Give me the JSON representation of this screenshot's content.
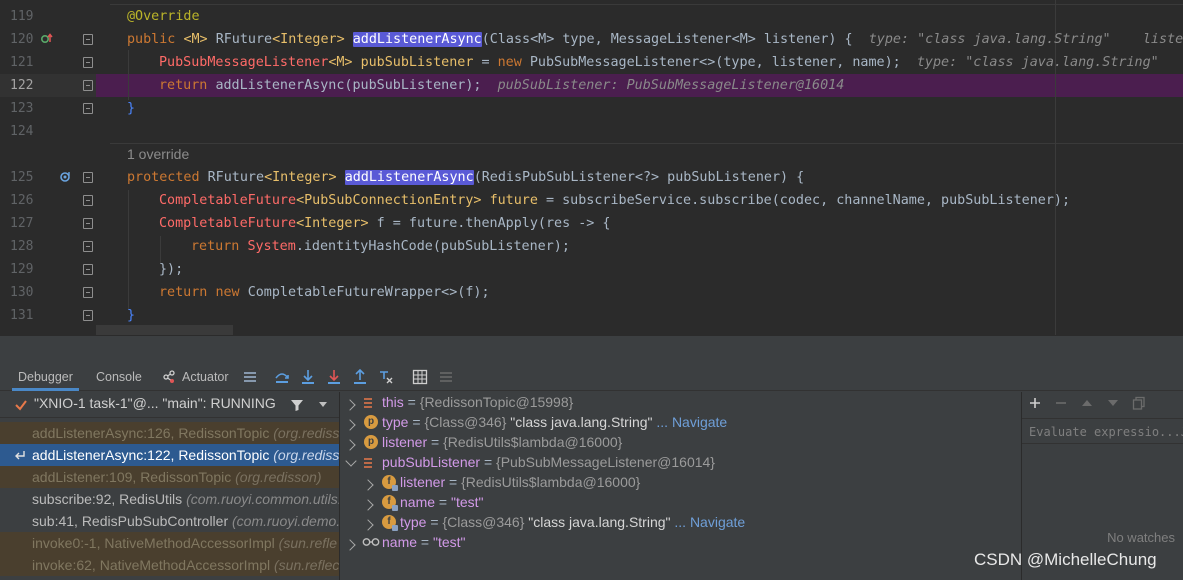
{
  "editor": {
    "lines": [
      {
        "num": "119"
      },
      {
        "num": "120"
      },
      {
        "num": "121"
      },
      {
        "num": "122"
      },
      {
        "num": "123"
      },
      {
        "num": "124"
      },
      {
        "num": "125"
      },
      {
        "num": "126"
      },
      {
        "num": "127"
      },
      {
        "num": "128"
      },
      {
        "num": "129"
      },
      {
        "num": "130"
      },
      {
        "num": "131"
      }
    ],
    "usage_hint": "1 override",
    "code": {
      "l119_ann": "@Override",
      "l120_kw": "public",
      "l120_gen": "<M>",
      "l120_type": "RFuture",
      "l120_tparam": "<Integer>",
      "l120_method": "addListenerAsync",
      "l120_params": "(Class<M> type, MessageListener<M> listener) {",
      "l120_hint": "type: \"class java.lang.String\"",
      "l120_hint2": "lister",
      "l121_type": "PubSubMessageListener",
      "l121_gen": "<M>",
      "l121_var": "pubSubListener",
      "l121_eq": " = ",
      "l121_new": "new",
      "l121_ctor": "PubSubMessageListener<>(type, listener, name);",
      "l121_hint": "type: \"class java.lang.String\"",
      "l122_kw": "return",
      "l122_call": "addListenerAsync(pubSubListener);",
      "l122_hint": "pubSubListener: PubSubMessageListener@16014",
      "l123_brace": "}",
      "l125_kw": "protected",
      "l125_type": "RFuture",
      "l125_tparam": "<Integer>",
      "l125_method": "addListenerAsync",
      "l125_params": "(RedisPubSubListener<?> pubSubListener) {",
      "l126_type": "CompletableFuture",
      "l126_gen": "<PubSubConnectionEntry>",
      "l126_var": "future",
      "l126_rest": " = subscribeService.subscribe(codec, channelName, pubSubListener);",
      "l127_type": "CompletableFuture",
      "l127_gen": "<Integer>",
      "l127_rest": " f = future.thenApply(res -> {",
      "l128_kw": "return",
      "l128_cls": "System",
      "l128_rest": ".identityHashCode(pubSubListener);",
      "l129_rest": "});",
      "l130_kw": "return",
      "l130_new": "new",
      "l130_rest": "CompletableFutureWrapper<>(f);",
      "l131_brace": "}"
    }
  },
  "debugger": {
    "tabs": {
      "debugger": "Debugger",
      "console": "Console",
      "actuator": "Actuator"
    },
    "thread": "\"XNIO-1 task-1\"@... \"main\": RUNNING",
    "frames": [
      {
        "method": "addListenerAsync:126, RedissonTopic",
        "pkg": "(org.redisso"
      },
      {
        "method": "addListenerAsync:122, RedissonTopic",
        "pkg": "(org.redisso"
      },
      {
        "method": "addListener:109, RedissonTopic",
        "pkg": "(org.redisson)"
      },
      {
        "method": "subscribe:92, RedisUtils",
        "pkg": "(com.ruoyi.common.utils.r"
      },
      {
        "method": "sub:41, RedisPubSubController",
        "pkg": "(com.ruoyi.demo.c"
      },
      {
        "method": "invoke0:-1, NativeMethodAccessorImpl",
        "pkg": "(sun.refle"
      },
      {
        "method": "invoke:62, NativeMethodAccessorImpl",
        "pkg": "(sun.reflec"
      }
    ],
    "vars": [
      {
        "name": "this",
        "eq": " = ",
        "val": "{RedissonTopic@15998}"
      },
      {
        "name": "type",
        "eq": " = ",
        "val": "{Class@346}",
        "str": " \"class java.lang.String\"",
        "nav": " ... Navigate"
      },
      {
        "name": "listener",
        "eq": " = ",
        "val": "{RedisUtils$lambda@16000}"
      },
      {
        "name": "pubSubListener",
        "eq": " = ",
        "val": "{PubSubMessageListener@16014}"
      },
      {
        "name": "listener",
        "eq": " = ",
        "val": "{RedisUtils$lambda@16000}"
      },
      {
        "name": "name",
        "eq": " = ",
        "str": "\"test\""
      },
      {
        "name": "type",
        "eq": " = ",
        "val": "{Class@346}",
        "str": " \"class java.lang.String\"",
        "nav": " ... Navigate"
      },
      {
        "name": "name",
        "eq": " = ",
        "str": "\"test\""
      }
    ],
    "watches": {
      "eval_placeholder": "Evaluate expressio...Ja",
      "empty": "No watches"
    }
  },
  "watermark": "CSDN @MichelleChung",
  "colors": {
    "editor_bg": "#2b2b2b",
    "panel_bg": "#3c3f41",
    "exec_line": "#4b1e4f",
    "selected_frame": "#2d5a90",
    "keyword": "#cc7832",
    "method": "#ffc66d",
    "selection_hl": "#5a5ad6"
  }
}
